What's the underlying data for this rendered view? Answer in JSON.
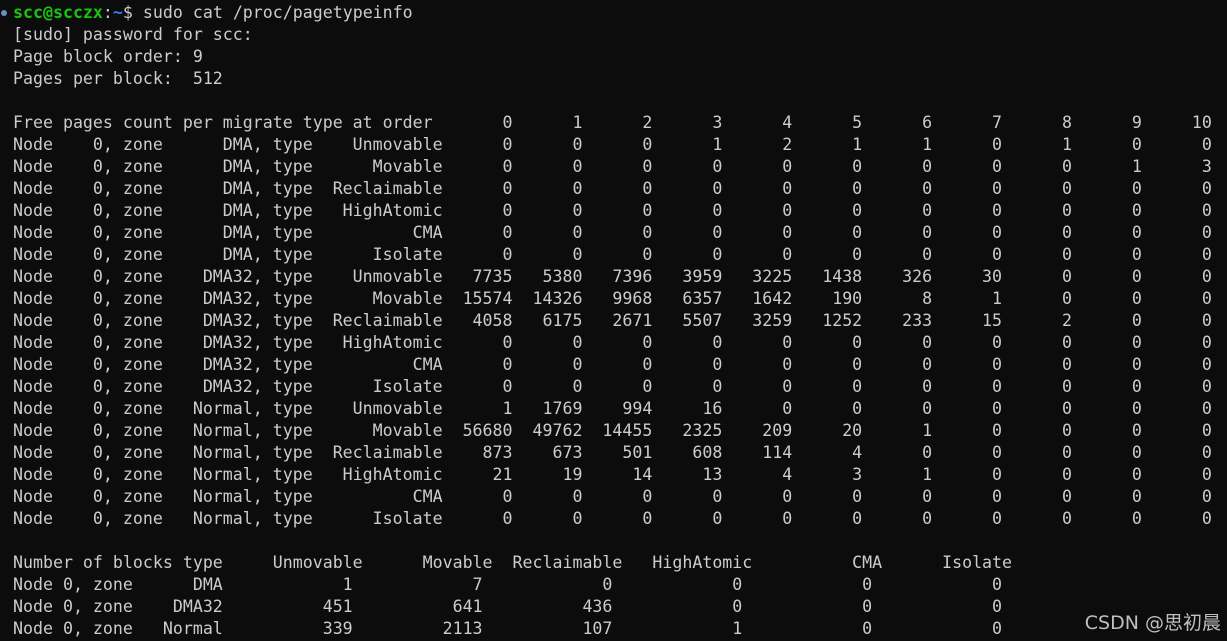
{
  "prompt": {
    "user_host": "scc@scczx",
    "sep": ":",
    "cwd": "~",
    "symbol": "$ ",
    "command": "sudo cat /proc/pagetypeinfo"
  },
  "output_lines": [
    "[sudo] password for scc:",
    "Page block order: 9",
    "Pages per block:  512",
    "",
    "Free pages count per migrate type at order       0      1      2      3      4      5      6      7      8      9     10",
    "Node    0, zone      DMA, type    Unmovable      0      0      0      1      2      1      1      0      1      0      0",
    "Node    0, zone      DMA, type      Movable      0      0      0      0      0      0      0      0      0      1      3",
    "Node    0, zone      DMA, type  Reclaimable      0      0      0      0      0      0      0      0      0      0      0",
    "Node    0, zone      DMA, type   HighAtomic      0      0      0      0      0      0      0      0      0      0      0",
    "Node    0, zone      DMA, type          CMA      0      0      0      0      0      0      0      0      0      0      0",
    "Node    0, zone      DMA, type      Isolate      0      0      0      0      0      0      0      0      0      0      0",
    "Node    0, zone    DMA32, type    Unmovable   7735   5380   7396   3959   3225   1438    326     30      0      0      0",
    "Node    0, zone    DMA32, type      Movable  15574  14326   9968   6357   1642    190      8      1      0      0      0",
    "Node    0, zone    DMA32, type  Reclaimable   4058   6175   2671   5507   3259   1252    233     15      2      0      0",
    "Node    0, zone    DMA32, type   HighAtomic      0      0      0      0      0      0      0      0      0      0      0",
    "Node    0, zone    DMA32, type          CMA      0      0      0      0      0      0      0      0      0      0      0",
    "Node    0, zone    DMA32, type      Isolate      0      0      0      0      0      0      0      0      0      0      0",
    "Node    0, zone   Normal, type    Unmovable      1   1769    994     16      0      0      0      0      0      0      0",
    "Node    0, zone   Normal, type      Movable  56680  49762  14455   2325    209     20      1      0      0      0      0",
    "Node    0, zone   Normal, type  Reclaimable    873    673    501    608    114      4      0      0      0      0      0",
    "Node    0, zone   Normal, type   HighAtomic     21     19     14     13      4      3      1      0      0      0      0",
    "Node    0, zone   Normal, type          CMA      0      0      0      0      0      0      0      0      0      0      0",
    "Node    0, zone   Normal, type      Isolate      0      0      0      0      0      0      0      0      0      0      0",
    "",
    "Number of blocks type     Unmovable      Movable  Reclaimable   HighAtomic          CMA      Isolate",
    "Node 0, zone      DMA            1            7            0            0            0            0",
    "Node 0, zone    DMA32          451          641          436            0            0            0",
    "Node 0, zone   Normal          339         2113          107            1            0            0"
  ],
  "watermark": "CSDN @思初晨",
  "colors": {
    "background": "#0c0c0c",
    "foreground": "#cccccc",
    "prompt_user": "#16c60c",
    "prompt_path": "#3b78ff"
  }
}
